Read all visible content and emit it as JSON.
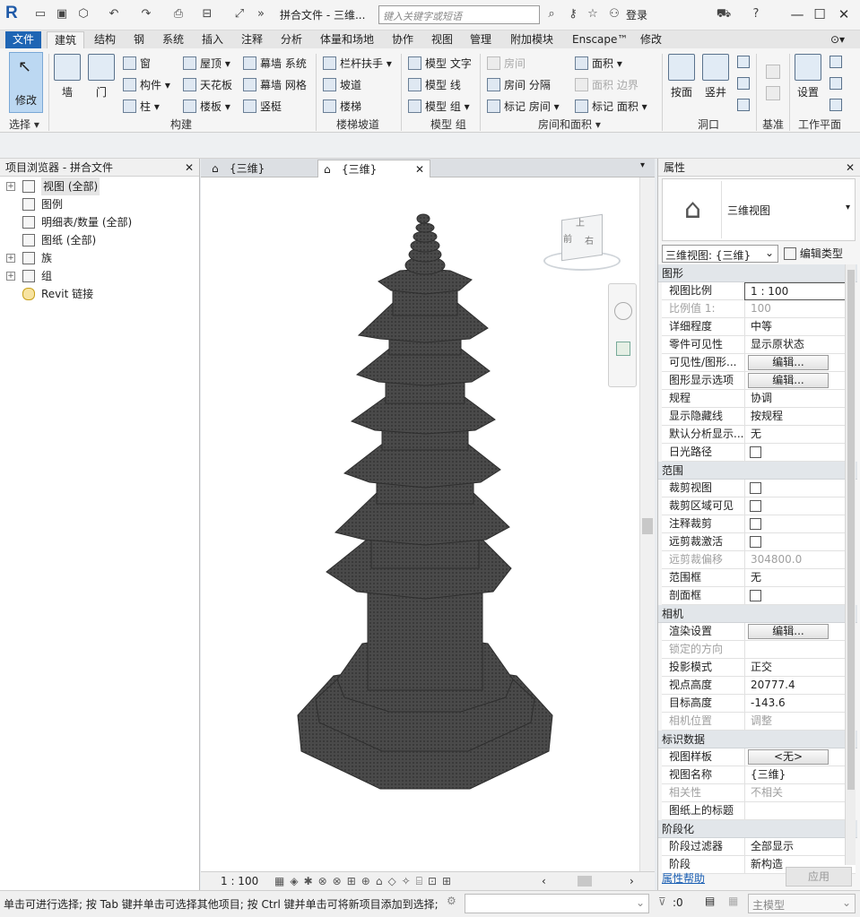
{
  "titlebar": {
    "app_logo": "R",
    "doc_title": "拼合文件 - 三维...",
    "search_placeholder": "键入关键字或短语",
    "login": "登录"
  },
  "tabs": [
    "文件",
    "建筑",
    "结构",
    "钢",
    "系统",
    "插入",
    "注释",
    "分析",
    "体量和场地",
    "协作",
    "视图",
    "管理",
    "附加模块",
    "Enscape™",
    "修改"
  ],
  "ribbon": {
    "modify_label": "修改",
    "select_group": "选择",
    "build_group": "构建",
    "stairs_group": "楼梯坡道",
    "model_group": "模型 组",
    "room_group": "房间和面积",
    "opening_group": "洞口",
    "datum_group": "基准",
    "workplane_group": "工作平面",
    "wall": "墙",
    "door": "门",
    "window": "窗",
    "component": "构件",
    "column": "柱",
    "roof": "屋顶",
    "ceiling": "天花板",
    "floor": "楼板",
    "curtain_system": "幕墙 系统",
    "curtain_grid": "幕墙 网格",
    "mullion": "竖梃",
    "railing": "栏杆扶手",
    "ramp": "坡道",
    "stair": "楼梯",
    "model_text": "模型 文字",
    "model_line": "模型 线",
    "room": "房间",
    "room_sep": "房间 分隔",
    "tag_room": "标记 房间",
    "area": "面积",
    "area_boundary": "面积 边界",
    "tag_area": "标记 面积",
    "by_face": "按面",
    "shaft": "竖井",
    "set": "设置"
  },
  "browser": {
    "title": "项目浏览器 - 拼合文件",
    "items": [
      "视图 (全部)",
      "图例",
      "明细表/数量 (全部)",
      "图纸 (全部)",
      "族",
      "组",
      "Revit 链接"
    ]
  },
  "doctabs": [
    "{三维}",
    "{三维}"
  ],
  "viewcube": {
    "front": "前",
    "right": "右",
    "top": "上"
  },
  "viewbar": {
    "scale": "1 : 100"
  },
  "properties": {
    "title": "属性",
    "type_name": "三维视图",
    "selector": "三维视图: {三维}",
    "edit_type": "编辑类型",
    "sections": [
      {
        "name": "图形",
        "rows": [
          {
            "k": "视图比例",
            "v": "1 : 100",
            "kind": "input"
          },
          {
            "k": "比例值 1:",
            "v": "100",
            "kind": "dim"
          },
          {
            "k": "详细程度",
            "v": "中等"
          },
          {
            "k": "零件可见性",
            "v": "显示原状态"
          },
          {
            "k": "可见性/图形...",
            "v": "编辑...",
            "kind": "btn"
          },
          {
            "k": "图形显示选项",
            "v": "编辑...",
            "kind": "btn"
          },
          {
            "k": "规程",
            "v": "协调"
          },
          {
            "k": "显示隐藏线",
            "v": "按规程"
          },
          {
            "k": "默认分析显示...",
            "v": "无"
          },
          {
            "k": "日光路径",
            "v": "",
            "kind": "cb"
          }
        ]
      },
      {
        "name": "范围",
        "rows": [
          {
            "k": "裁剪视图",
            "v": "",
            "kind": "cb"
          },
          {
            "k": "裁剪区域可见",
            "v": "",
            "kind": "cb"
          },
          {
            "k": "注释裁剪",
            "v": "",
            "kind": "cb"
          },
          {
            "k": "远剪裁激活",
            "v": "",
            "kind": "cb"
          },
          {
            "k": "远剪裁偏移",
            "v": "304800.0",
            "kind": "dim"
          },
          {
            "k": "范围框",
            "v": "无"
          },
          {
            "k": "剖面框",
            "v": "",
            "kind": "cb"
          }
        ]
      },
      {
        "name": "相机",
        "rows": [
          {
            "k": "渲染设置",
            "v": "编辑...",
            "kind": "btn"
          },
          {
            "k": "锁定的方向",
            "v": "",
            "kind": "dim"
          },
          {
            "k": "投影模式",
            "v": "正交"
          },
          {
            "k": "视点高度",
            "v": "20777.4"
          },
          {
            "k": "目标高度",
            "v": "-143.6"
          },
          {
            "k": "相机位置",
            "v": "调整",
            "kind": "dim"
          }
        ]
      },
      {
        "name": "标识数据",
        "rows": [
          {
            "k": "视图样板",
            "v": "<无>",
            "kind": "btn"
          },
          {
            "k": "视图名称",
            "v": "{三维}"
          },
          {
            "k": "相关性",
            "v": "不相关",
            "kind": "dim"
          },
          {
            "k": "图纸上的标题",
            "v": ""
          }
        ]
      },
      {
        "name": "阶段化",
        "rows": [
          {
            "k": "阶段过滤器",
            "v": "全部显示"
          },
          {
            "k": "阶段",
            "v": "新构造"
          }
        ]
      }
    ],
    "help_link": "属性帮助",
    "apply": "应用"
  },
  "status": {
    "hint": "单击可进行选择; 按 Tab 键并单击可选择其他项目; 按 Ctrl 键并单击可将新项目添加到选择;",
    "count": ":0",
    "model": "主模型"
  }
}
